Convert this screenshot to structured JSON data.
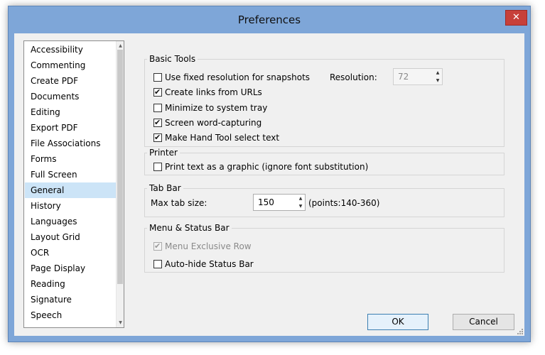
{
  "window": {
    "title": "Preferences",
    "close_glyph": "✕"
  },
  "categories": {
    "items": [
      "Accessibility",
      "Commenting",
      "Create PDF",
      "Documents",
      "Editing",
      "Export PDF",
      "File Associations",
      "Forms",
      "Full Screen",
      "General",
      "History",
      "Languages",
      "Layout Grid",
      "OCR",
      "Page Display",
      "Reading",
      "Signature",
      "Speech"
    ],
    "selected": "General"
  },
  "basic_tools": {
    "label": "Basic Tools",
    "fixed_resolution": {
      "label": "Use fixed resolution for snapshots",
      "checked": false
    },
    "resolution_label": "Resolution:",
    "resolution_value": "72",
    "create_links": {
      "label": "Create links from URLs",
      "checked": true
    },
    "minimize_tray": {
      "label": "Minimize to system tray",
      "checked": false
    },
    "word_capturing": {
      "label": "Screen word-capturing",
      "checked": true
    },
    "hand_tool": {
      "label": "Make Hand Tool select text",
      "checked": true
    }
  },
  "printer": {
    "label": "Printer",
    "print_graphic": {
      "label": "Print text as a graphic (ignore font substitution)",
      "checked": false
    }
  },
  "tab_bar": {
    "label": "Tab Bar",
    "max_size_label": "Max tab size:",
    "max_size_value": "150",
    "range_hint": "(points:140-360)"
  },
  "menu_status": {
    "label": "Menu & Status Bar",
    "menu_exclusive": {
      "label": "Menu Exclusive Row",
      "checked": true,
      "disabled": true
    },
    "autohide_status": {
      "label": "Auto-hide Status Bar",
      "checked": false
    }
  },
  "buttons": {
    "ok": "OK",
    "cancel": "Cancel"
  },
  "icons": {
    "spin_up": "▲",
    "spin_down": "▼",
    "close": "close-icon"
  }
}
